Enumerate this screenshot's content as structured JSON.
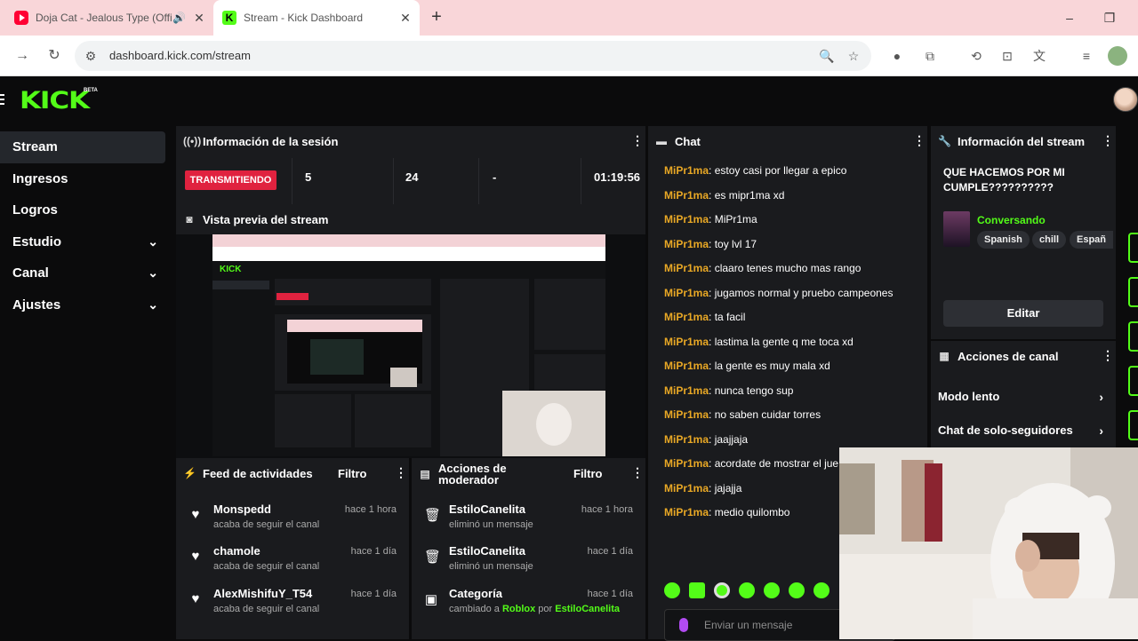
{
  "browser": {
    "tabs": [
      {
        "title": "Doja Cat - Jealous Type (Offi",
        "icon": "youtube-icon"
      },
      {
        "title": "Stream - Kick Dashboard",
        "icon": "kick-icon"
      }
    ],
    "url": "dashboard.kick.com/stream"
  },
  "kick": {
    "logo": "KICK",
    "beta": "BETA"
  },
  "sidebar": {
    "items": [
      {
        "label": "Stream",
        "active": true
      },
      {
        "label": "Ingresos"
      },
      {
        "label": "Logros"
      },
      {
        "label": "Estudio",
        "expandable": true
      },
      {
        "label": "Canal",
        "expandable": true
      },
      {
        "label": "Ajustes",
        "expandable": true
      }
    ]
  },
  "session": {
    "title": "Información de la sesión",
    "live_label": "TRANSMITIENDO",
    "stats": [
      "5",
      "24",
      "-",
      "01:19:56"
    ]
  },
  "preview": {
    "title": "Vista previa del stream"
  },
  "feed": {
    "title": "Feed de actividades",
    "filter_label": "Filtro",
    "items": [
      {
        "name": "Monspedd",
        "sub": "acaba de seguir el canal",
        "time": "hace 1 hora"
      },
      {
        "name": "chamole",
        "sub": "acaba de seguir el canal",
        "time": "hace 1 día"
      },
      {
        "name": "AlexMishifuY_T54",
        "sub": "acaba de seguir el canal",
        "time": "hace 1 día"
      }
    ]
  },
  "mod_actions": {
    "title_line1": "Acciones de",
    "title_line2": "moderador",
    "filter_label": "Filtro",
    "items": [
      {
        "name": "EstiloCanelita",
        "sub": "eliminó un mensaje",
        "time": "hace 1 hora"
      },
      {
        "name": "EstiloCanelita",
        "sub": "eliminó un mensaje",
        "time": "hace 1 día"
      },
      {
        "name": "Categoría",
        "sub_prefix": "cambiado a",
        "sub_cat": "Roblox",
        "sub_mid": "por",
        "sub_user": "EstiloCanelita",
        "time": "hace 1 día"
      }
    ]
  },
  "chat": {
    "title": "Chat",
    "messages": [
      {
        "user": "MiPr1ma",
        "text": "estoy casi por llegar a epico"
      },
      {
        "user": "MiPr1ma",
        "text": "es mipr1ma xd"
      },
      {
        "user": "MiPr1ma",
        "text": "MiPr1ma"
      },
      {
        "user": "MiPr1ma",
        "text": "toy lvl 17"
      },
      {
        "user": "MiPr1ma",
        "text": "claaro tenes mucho mas rango"
      },
      {
        "user": "MiPr1ma",
        "text": "jugamos normal y pruebo campeones"
      },
      {
        "user": "MiPr1ma",
        "text": "ta facil"
      },
      {
        "user": "MiPr1ma",
        "text": "lastima la gente q me toca xd"
      },
      {
        "user": "MiPr1ma",
        "text": "la gente es muy mala xd"
      },
      {
        "user": "MiPr1ma",
        "text": "nunca tengo sup"
      },
      {
        "user": "MiPr1ma",
        "text": "no saben cuidar torres"
      },
      {
        "user": "MiPr1ma",
        "text": "jaajjaja"
      },
      {
        "user": "MiPr1ma",
        "text": "acordate de mostrar el jue"
      },
      {
        "user": "MiPr1ma",
        "text": "jajajja"
      },
      {
        "user": "MiPr1ma",
        "text": "medio quilombo"
      }
    ],
    "input_placeholder": "Enviar un mensaje"
  },
  "stream_info": {
    "title": "Información del stream",
    "stream_title": "QUE HACEMOS POR MI CUMPLE??????????",
    "category": "Conversando",
    "tags": [
      "Spanish",
      "chill",
      "Españ"
    ],
    "edit_label": "Editar"
  },
  "channel_actions": {
    "title": "Acciones de canal",
    "items": [
      "Modo lento",
      "Chat de solo-seguidores"
    ]
  },
  "colors": {
    "kick_green": "#53fc18",
    "live_red": "#e0223f",
    "chat_user": "#e9a825",
    "panel_bg": "#1a1b1e"
  }
}
